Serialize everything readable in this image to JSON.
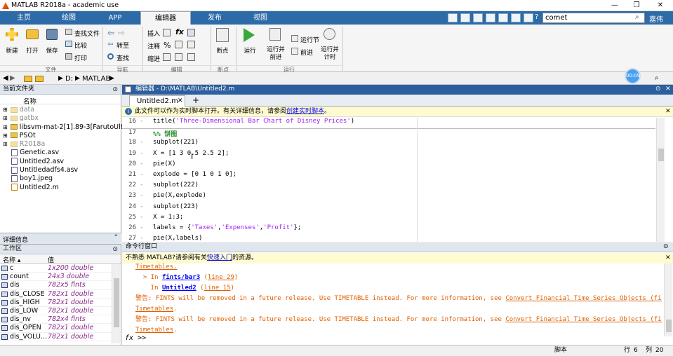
{
  "window": {
    "title": "MATLAB R2018a - academic use"
  },
  "tabs": [
    "主页",
    "绘图",
    "APP",
    "编辑器",
    "发布",
    "视图"
  ],
  "search": {
    "value": "comet",
    "user": "嘉伟"
  },
  "ribbon": {
    "file": {
      "new": "新建",
      "open": "打开",
      "save": "保存",
      "find_files": "查找文件",
      "compare": "比较",
      "print": "打印",
      "group": "文件"
    },
    "nav": {
      "goto": "转至",
      "find": "查找",
      "group": "导航"
    },
    "edit": {
      "insert": "插入",
      "comment": "注释",
      "indent": "缩进",
      "fx": "fx",
      "group": "编辑"
    },
    "breakpoints": {
      "label": "断点",
      "group": "断点"
    },
    "run": {
      "run": "运行",
      "run_advance": "运行并前进",
      "run_section": "运行节",
      "advance": "前进",
      "run_time": "运行并计时",
      "group": "运行"
    }
  },
  "address": {
    "path": [
      "D:",
      "MATLAB"
    ],
    "timer": "00:09"
  },
  "current_folder": {
    "title": "当前文件夹",
    "column": "名称",
    "items": [
      {
        "name": "data",
        "type": "folder",
        "faded": true
      },
      {
        "name": "gatbx",
        "type": "folder",
        "faded": true
      },
      {
        "name": "libsvm-mat-2[1].89-3[FarutoUlti...",
        "type": "folder",
        "faded": false
      },
      {
        "name": "PSOt",
        "type": "folder",
        "faded": false
      },
      {
        "name": "R2018a",
        "type": "folder",
        "faded": true
      },
      {
        "name": "Genetic.asv",
        "type": "file",
        "faded": false
      },
      {
        "name": "Untitled2.asv",
        "type": "file",
        "faded": false
      },
      {
        "name": "Untitledadfs4.asv",
        "type": "file",
        "faded": false
      },
      {
        "name": "boy1.jpeg",
        "type": "file",
        "faded": false
      },
      {
        "name": "Untitled2.m",
        "type": "mfile",
        "faded": false
      }
    ]
  },
  "details": {
    "title": "详细信息"
  },
  "workspace": {
    "title": "工作区",
    "columns": [
      "名称 ▴",
      "值"
    ],
    "rows": [
      {
        "name": "c",
        "value": "1x200 double"
      },
      {
        "name": "count",
        "value": "24x3 double"
      },
      {
        "name": "dis",
        "value": "782x5 fints"
      },
      {
        "name": "dis_CLOSE",
        "value": "782x1 double"
      },
      {
        "name": "dis_HIGH",
        "value": "782x1 double"
      },
      {
        "name": "dis_LOW",
        "value": "782x1 double"
      },
      {
        "name": "dis_nv",
        "value": "782x4 fints"
      },
      {
        "name": "dis_OPEN",
        "value": "782x1 double"
      },
      {
        "name": "dis_VOLU...",
        "value": "782x1 double"
      }
    ]
  },
  "editor": {
    "title": "编辑器 - D:\\MATLAB\\Untitled2.m",
    "tab": "Untitled2.m",
    "plus": "+",
    "info": "此文件可以作为实时脚本打开。有关详细信息，请参阅",
    "info_link": "创建实时脚本",
    "info_end": "。",
    "lines": [
      {
        "n": "16",
        "dash": "-",
        "parts": [
          [
            "title(",
            ""
          ],
          [
            "'Three-Dimensional Bar Chart of Disney Prices'",
            "str"
          ],
          [
            ")",
            ""
          ]
        ]
      },
      {
        "n": "17",
        "dash": "",
        "parts": [
          [
            "%% 饼图",
            "cmt"
          ]
        ]
      },
      {
        "n": "18",
        "dash": "-",
        "parts": [
          [
            "subplot(221)",
            ""
          ]
        ]
      },
      {
        "n": "19",
        "dash": "-",
        "parts": [
          [
            "X = [1 3 0.5 2.5 2];",
            ""
          ]
        ]
      },
      {
        "n": "20",
        "dash": "-",
        "parts": [
          [
            "pie(X)",
            ""
          ]
        ]
      },
      {
        "n": "21",
        "dash": "-",
        "parts": [
          [
            "explode = [0 1 0 1 0];",
            ""
          ]
        ]
      },
      {
        "n": "22",
        "dash": "-",
        "parts": [
          [
            "subplot(222)",
            ""
          ]
        ]
      },
      {
        "n": "23",
        "dash": "-",
        "parts": [
          [
            "pie(X,explode)",
            ""
          ]
        ]
      },
      {
        "n": "24",
        "dash": "-",
        "parts": [
          [
            "subplot(223)",
            ""
          ]
        ]
      },
      {
        "n": "25",
        "dash": "-",
        "parts": [
          [
            "X = 1:3;",
            ""
          ]
        ]
      },
      {
        "n": "26",
        "dash": "-",
        "parts": [
          [
            "labels = {",
            ""
          ],
          [
            "'Taxes'",
            "str"
          ],
          [
            ",",
            ""
          ],
          [
            "'Expenses'",
            "str"
          ],
          [
            ",",
            ""
          ],
          [
            "'Profit'",
            "str"
          ],
          [
            "};",
            ""
          ]
        ]
      },
      {
        "n": "27",
        "dash": "-",
        "parts": [
          [
            "pie(X,labels)",
            ""
          ]
        ]
      }
    ]
  },
  "command": {
    "title": "命令行窗口",
    "info": "不熟悉 MATLAB?请参阅有关",
    "info_link": "快速入门",
    "info_end": "的资源。",
    "prompt": "fx >>",
    "lines": [
      [
        [
          "Timetables.",
          "wlink"
        ]
      ],
      [
        [
          "  > In ",
          "warn"
        ],
        [
          "fints/bar3",
          "link"
        ],
        [
          " (",
          "warn"
        ],
        [
          "line 29",
          "wlink"
        ],
        [
          ")",
          "warn"
        ]
      ],
      [
        [
          "    In ",
          "warn"
        ],
        [
          "Untitled2",
          "link"
        ],
        [
          " (",
          "warn"
        ],
        [
          "line 15",
          "wlink"
        ],
        [
          ")",
          "warn"
        ]
      ],
      [
        [
          "警告: FINTS will be removed in a future release. Use TIMETABLE instead. For more information, see ",
          "warn"
        ],
        [
          "Convert Financial Time Series Objects (fints) to",
          "wlink"
        ]
      ],
      [
        [
          "Timetables",
          "wlink"
        ],
        [
          ".",
          "warn"
        ]
      ],
      [
        [
          "警告: FINTS will be removed in a future release. Use TIMETABLE instead. For more information, see ",
          "warn"
        ],
        [
          "Convert Financial Time Series Objects (fints) to",
          "wlink"
        ]
      ],
      [
        [
          "Timetables",
          "wlink"
        ],
        [
          ".",
          "warn"
        ]
      ]
    ]
  },
  "status": {
    "mode": "脚本",
    "row_label": "行",
    "row": "6",
    "col_label": "列",
    "col": "20"
  },
  "colors": {
    "ribbon_tabs": "#2c6aa8",
    "editor_header": "#2c5f9e",
    "info_bar": "#fffbd0",
    "warning": "#e06000",
    "string": "#a020f0",
    "comment": "#228b22"
  }
}
